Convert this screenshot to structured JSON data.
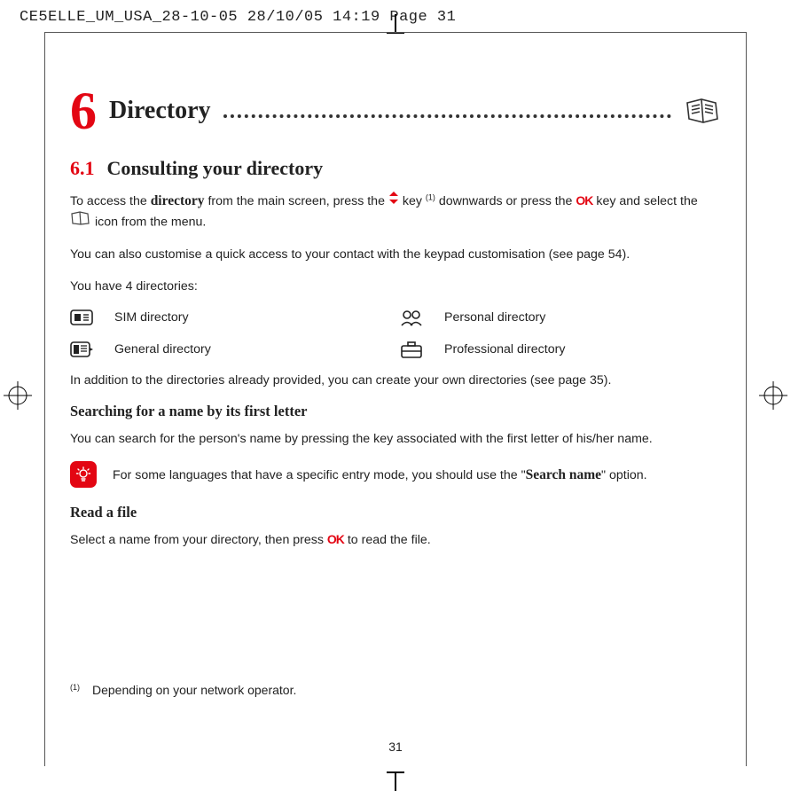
{
  "print_header": "CE5ELLE_UM_USA_28-10-05  28/10/05  14:19  Page 31",
  "chapter_num": "6",
  "chapter_title": "Directory",
  "section": {
    "num": "6.1",
    "title": "Consulting your directory"
  },
  "para1_a": "To access the ",
  "para1_bold": "directory",
  "para1_b": " from the main screen, press the ",
  "para1_c": " key ",
  "para1_sup": "(1)",
  "para1_d": " downwards or press the ",
  "ok_label": "OK",
  "para1_e": " key and select the ",
  "para1_f": " icon from the menu.",
  "para2": "You can also customise a quick access to your contact with the keypad customisation (see page 54).",
  "para3": "You have 4 directories:",
  "directories": {
    "sim": "SIM directory",
    "general": "General directory",
    "personal": "Personal directory",
    "professional": "Professional directory"
  },
  "para4": "In addition to the directories already provided, you can create your own directories (see page 35).",
  "subheading1": "Searching for a name by its first letter",
  "para5": "You can search for the person's name by pressing the key associated with the first letter of his/her name.",
  "tip_a": "For some languages that have a specific entry mode, you should use the \"",
  "tip_bold": "Search name",
  "tip_b": "\" option.",
  "subheading2": "Read a file",
  "para6_a": "Select a name from your directory, then press ",
  "para6_b": " to read the file.",
  "footnote_mark": "(1)",
  "footnote_text": "Depending on your network operator.",
  "page_number": "31"
}
